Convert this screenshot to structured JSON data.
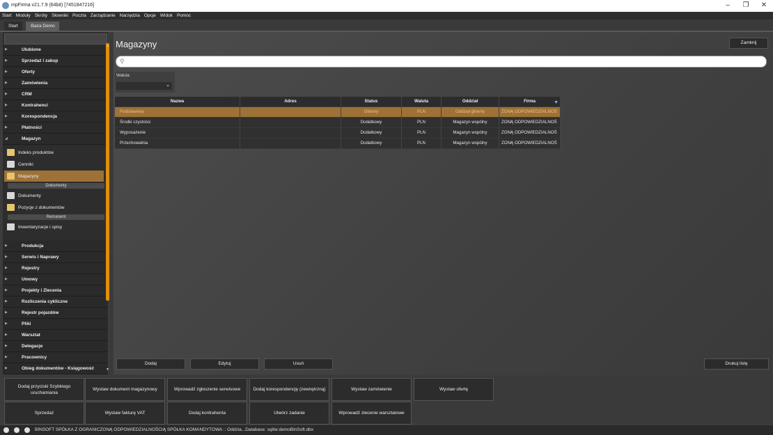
{
  "window": {
    "title": "mpFirma v21.7.9 (64bit) [7451847216]",
    "min": "–",
    "max": "❐",
    "close": "✕"
  },
  "menu": [
    "Start",
    "Moduły",
    "Skróty",
    "Słowniki",
    "Poczta",
    "Zarządzanie",
    "Narzędzia",
    "Opcje",
    "Widok",
    "Pomoc"
  ],
  "tabs": [
    "Start",
    ":Baza Demo"
  ],
  "sidebar": {
    "top_headers": [
      "Ulubione",
      "Sprzedaż i zakup",
      "Oferty",
      "Zamówienia",
      "CRM",
      "Kontrahenci",
      "Korespondencja",
      "Płatności",
      "Magazyn"
    ],
    "items": [
      "Indeks produktów",
      "Cenniki",
      "Magazyny"
    ],
    "sub1": "Dokumenty",
    "items2": [
      "Dokumenty",
      "Pozycje z dokumentów"
    ],
    "sub2": "Remanent",
    "items3": [
      "Inwentaryzacje i spisy"
    ],
    "bottom_headers": [
      "Produkcja",
      "Serwis i Naprawy",
      "Rejestry",
      "Umowy",
      "Projekty i Zlecenia",
      "Rozliczenia cykliczne",
      "Rejestr pojazdów",
      "Pliki",
      "Warsztat",
      "Delegacje",
      "Pracownicy",
      "Obieg dokumentów - Księgowość"
    ]
  },
  "main": {
    "title": "Magazyny",
    "close_label": "Zamknij",
    "search_placeholder": "",
    "waluta_label": "Waluta:",
    "waluta_value": "",
    "columns": [
      "Nazwa",
      "Adres",
      "Status",
      "Waluta",
      "Oddział",
      "Firma"
    ],
    "rows": [
      [
        "Podstawowy",
        "",
        "Główny",
        "PLN",
        "Oddział główny",
        "ZONĄ ODPOWIEDZIALNOŚ"
      ],
      [
        "Środki czystości",
        "",
        "Dodatkowy",
        "PLN",
        "Magazyn wspólny",
        "ZONĄ ODPOWIEDZIALNOŚ"
      ],
      [
        "Wyposażenie",
        "",
        "Dodatkowy",
        "PLN",
        "Magazyn wspólny",
        "ZONĄ ODPOWIEDZIALNOŚ"
      ],
      [
        "Przechowalnia",
        "",
        "Dodatkowy",
        "PLN",
        "Magazyn wspólny",
        "ZONĄ ODPOWIEDZIALNOŚ"
      ]
    ],
    "buttons": {
      "dodaj": "Dodaj",
      "edytuj": "Edytuj",
      "usun": "Usuń",
      "drukuj": "Drukuj listę"
    }
  },
  "actions": [
    "Dodaj przyciski Szybkiego uruchamiania",
    "Wystaw dokument magazynowy",
    "Wprowadź zgłoszenie serwisowe",
    "Dodaj korespondencję (zewnętrzną)",
    "Wystaw zamówienie",
    "Wystaw ofertę",
    "Sprzedaż",
    "Wystaw fakturę VAT",
    "Dodaj kontrahenta",
    "Utwórz zadanie",
    "Wprowadź zlecenie warsztatowe"
  ],
  "status": "BINSOFT SPÓŁKA Z OGRANICZONĄ ODPOWIEDZIALNOŚCIĄ SPÓŁKA KOMANDYTOWA :: Oddzia...Database: sqlite:demoBinSoft.dbx",
  "colors": {
    "accent": "#9e7136",
    "scrollbar": "#e08e0b",
    "filter": "#7cb9ff"
  }
}
